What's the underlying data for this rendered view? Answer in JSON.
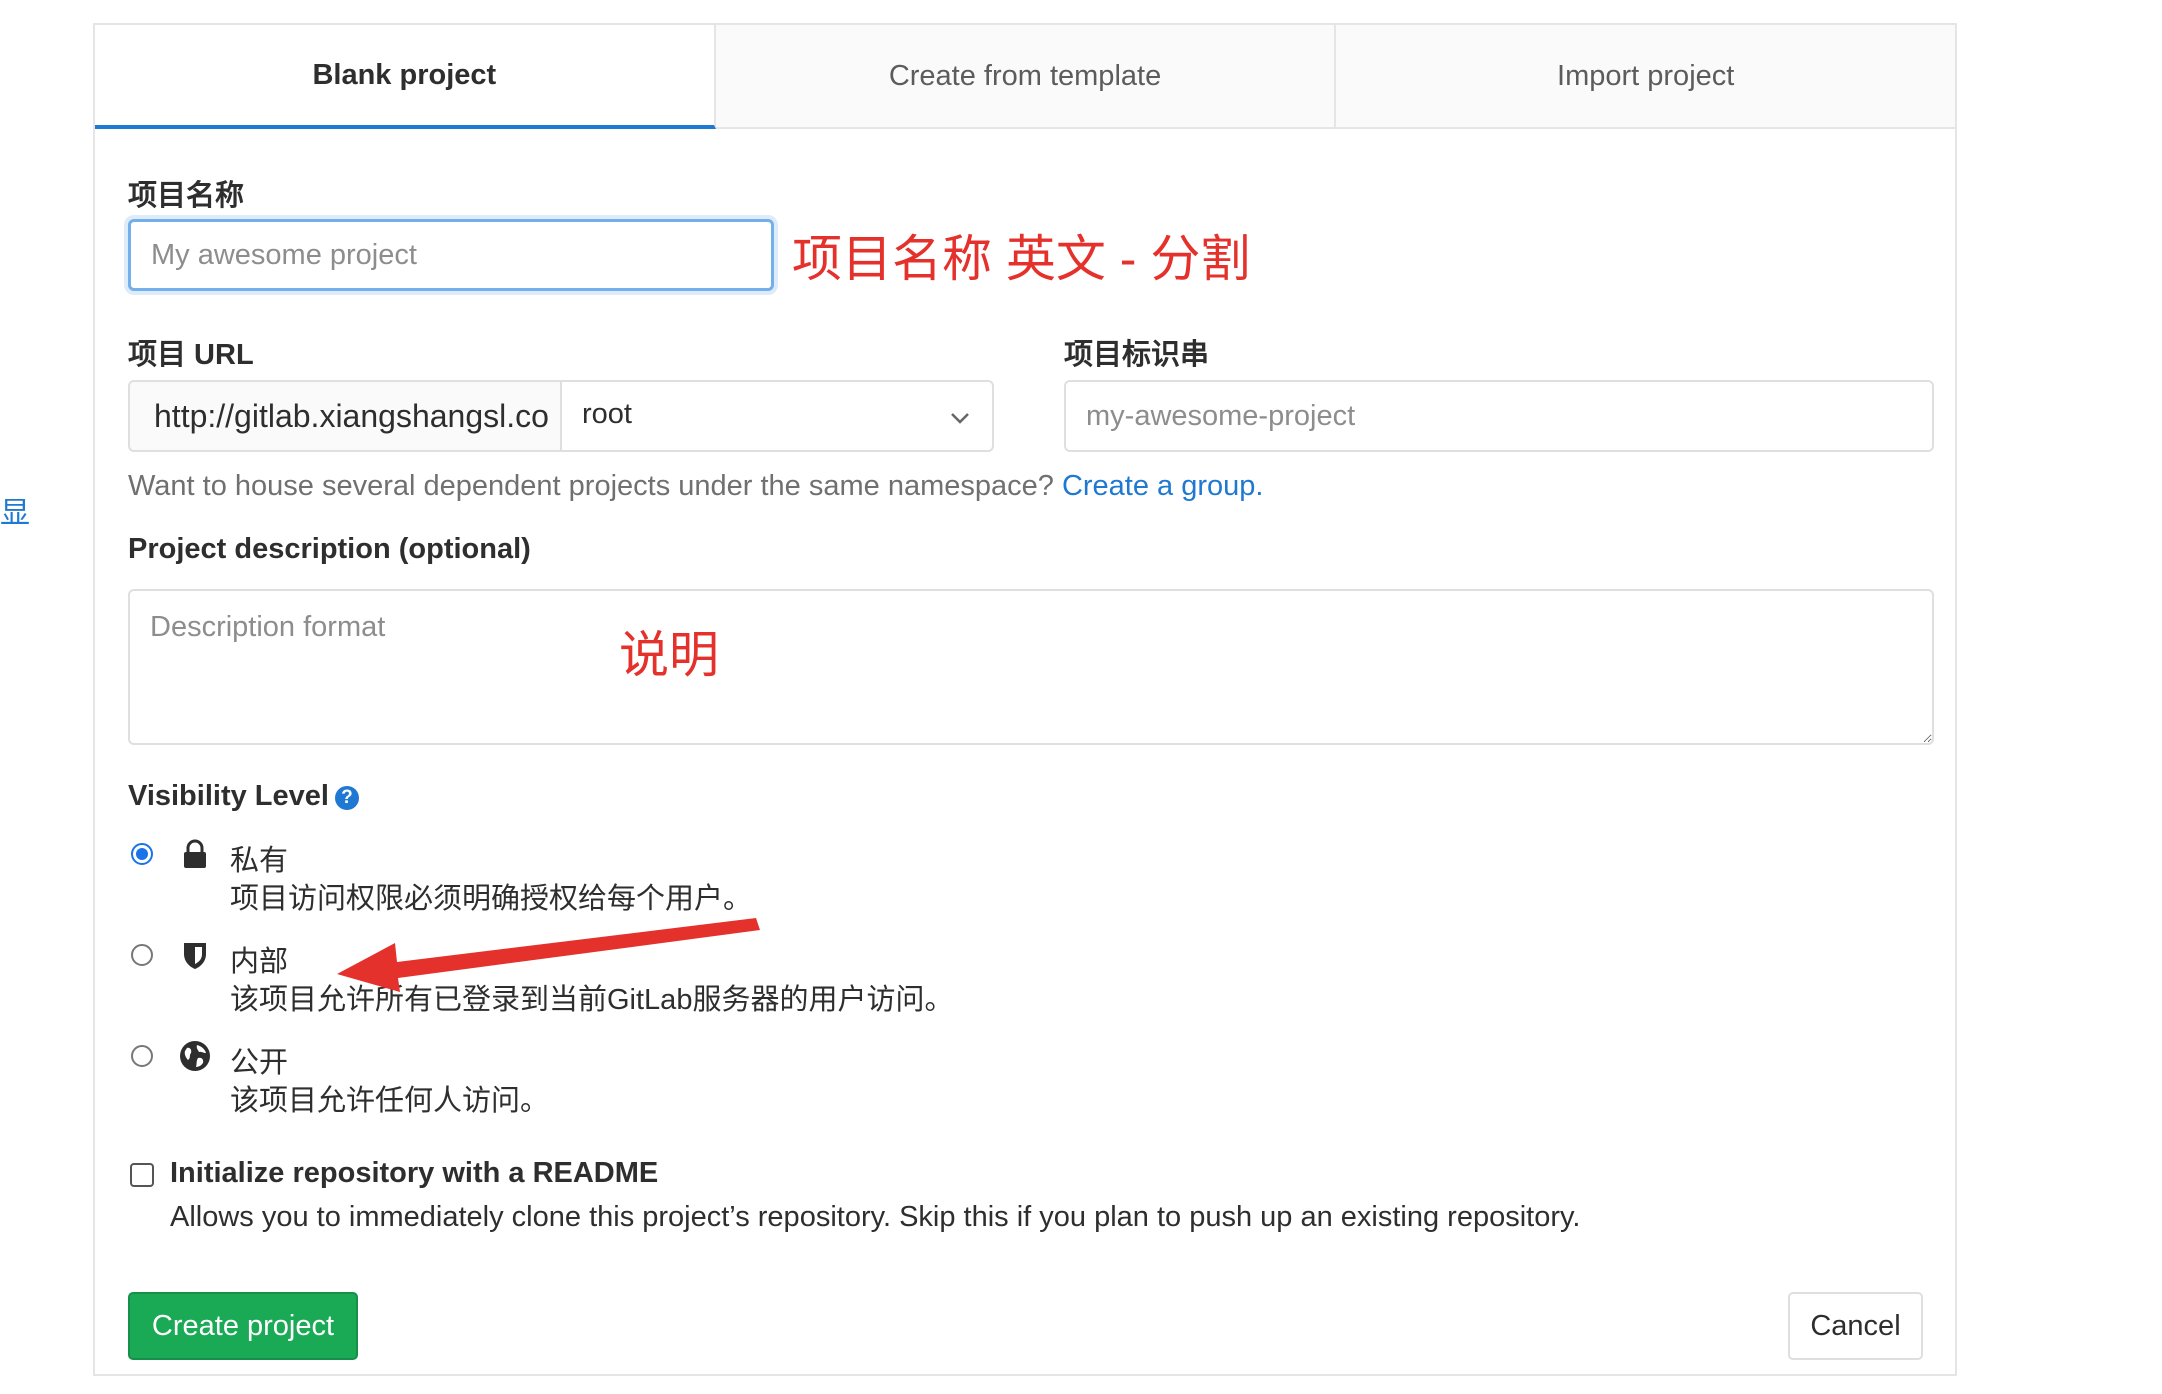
{
  "sidebar": {
    "partial_char": "显"
  },
  "tabs": [
    {
      "label": "Blank project",
      "active": true
    },
    {
      "label": "Create from template",
      "active": false
    },
    {
      "label": "Import project",
      "active": false
    }
  ],
  "form": {
    "project_name": {
      "label": "项目名称",
      "placeholder": "My awesome project",
      "value": ""
    },
    "project_url": {
      "label": "项目 URL",
      "prefix": "http://gitlab.xiangshangsl.co",
      "namespace": "root"
    },
    "project_slug": {
      "label": "项目标识串",
      "placeholder": "my-awesome-project",
      "value": ""
    },
    "group_help": {
      "text": "Want to house several dependent projects under the same namespace?",
      "link": "Create a group."
    },
    "description": {
      "label": "Project description (optional)",
      "placeholder": "Description format",
      "value": ""
    },
    "visibility": {
      "label": "Visibility Level",
      "help_icon": "question-circle-icon",
      "options": [
        {
          "title": "私有",
          "description": "项目访问权限必须明确授权给每个用户。",
          "icon": "lock-icon",
          "checked": true
        },
        {
          "title": "内部",
          "description": "该项目允许所有已登录到当前GitLab服务器的用户访问。",
          "icon": "shield-icon",
          "checked": false
        },
        {
          "title": "公开",
          "description": "该项目允许任何人访问。",
          "icon": "globe-icon",
          "checked": false
        }
      ]
    },
    "readme": {
      "label": "Initialize repository with a README",
      "description": "Allows you to immediately clone this project’s repository. Skip this if you plan to push up an existing repository.",
      "checked": false
    },
    "buttons": {
      "create": "Create project",
      "cancel": "Cancel"
    }
  },
  "annotations": {
    "name_note": "项目名称 英文 - 分割",
    "description_note": "说明",
    "arrow_color": "#e4312b"
  },
  "colors": {
    "primary_blue": "#1f78d1",
    "create_green": "#1aaa55",
    "annotation_red": "#e4312b"
  }
}
